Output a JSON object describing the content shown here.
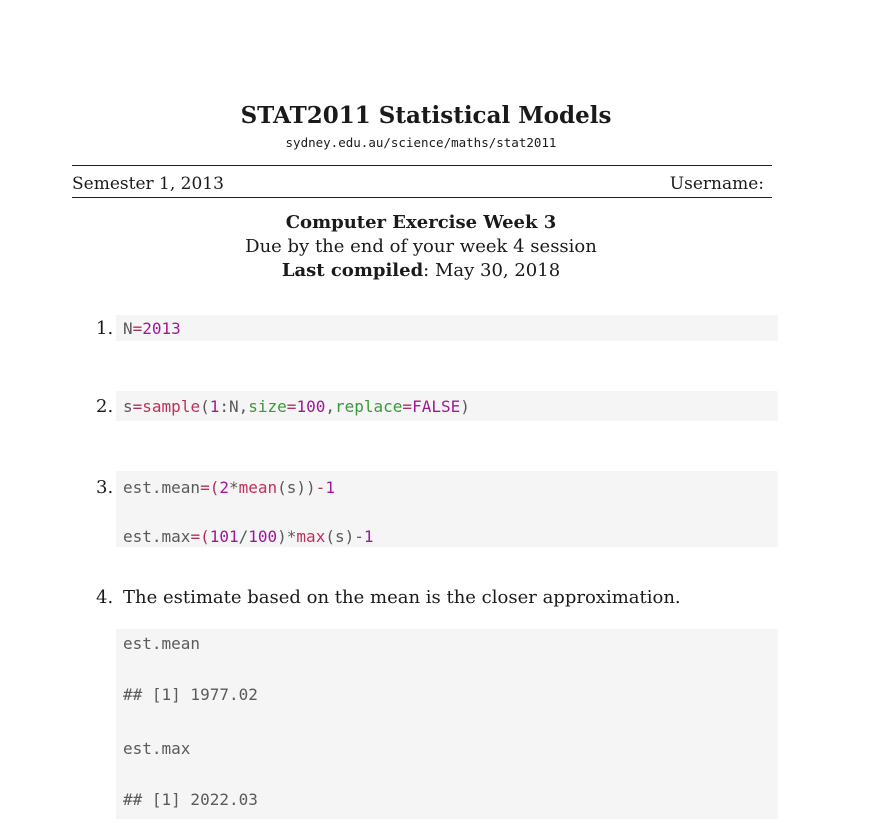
{
  "header": {
    "title": "STAT2011 Statistical Models",
    "url": "sydney.edu.au/science/maths/stat2011",
    "semester": "Semester 1, 2013",
    "username_label": "Username:",
    "exercise_title": "Computer Exercise Week 3",
    "due": "Due by the end of your week 4 session",
    "compiled_label": "Last compiled",
    "compiled_date": ": May 30, 2018"
  },
  "items": [
    {
      "number": "1.",
      "code": [
        [
          "N",
          "plain"
        ],
        [
          "=",
          "kw"
        ],
        [
          "2013",
          "lit"
        ]
      ]
    },
    {
      "number": "2.",
      "code": [
        [
          "s",
          "plain"
        ],
        [
          "=",
          "kw"
        ],
        [
          "sample",
          "fn"
        ],
        [
          "(",
          "plain"
        ],
        [
          "1",
          "lit"
        ],
        [
          ":N,",
          "plain"
        ],
        [
          "size",
          "arg"
        ],
        [
          "=",
          "kw"
        ],
        [
          "100",
          "lit"
        ],
        [
          ",",
          "plain"
        ],
        [
          "replace",
          "arg"
        ],
        [
          "=",
          "kw"
        ],
        [
          "FALSE",
          "lit"
        ],
        [
          ")",
          "plain"
        ]
      ]
    },
    {
      "number": "3.",
      "code_lines": [
        [
          [
            "est.mean",
            "plain"
          ],
          [
            "=(",
            "kw"
          ],
          [
            "2",
            "lit"
          ],
          [
            "*",
            "plain"
          ],
          [
            "mean",
            "fn"
          ],
          [
            "(s))",
            "plain"
          ],
          [
            "-",
            "kw"
          ],
          [
            "1",
            "lit"
          ]
        ],
        [
          [
            "est.max",
            "plain"
          ],
          [
            "=(",
            "kw"
          ],
          [
            "101",
            "lit"
          ],
          [
            "/",
            "plain"
          ],
          [
            "100",
            "lit"
          ],
          [
            ")*",
            "plain"
          ],
          [
            "max",
            "fn"
          ],
          [
            "(s)",
            "plain"
          ],
          [
            "-",
            "kw"
          ],
          [
            "1",
            "lit"
          ]
        ]
      ]
    },
    {
      "number": "4.",
      "text": "The estimate based on the mean is the closer approximation.",
      "output_lines": [
        "est.mean",
        "## [1] 1977.02",
        "est.max",
        "## [1] 2022.03"
      ]
    }
  ]
}
